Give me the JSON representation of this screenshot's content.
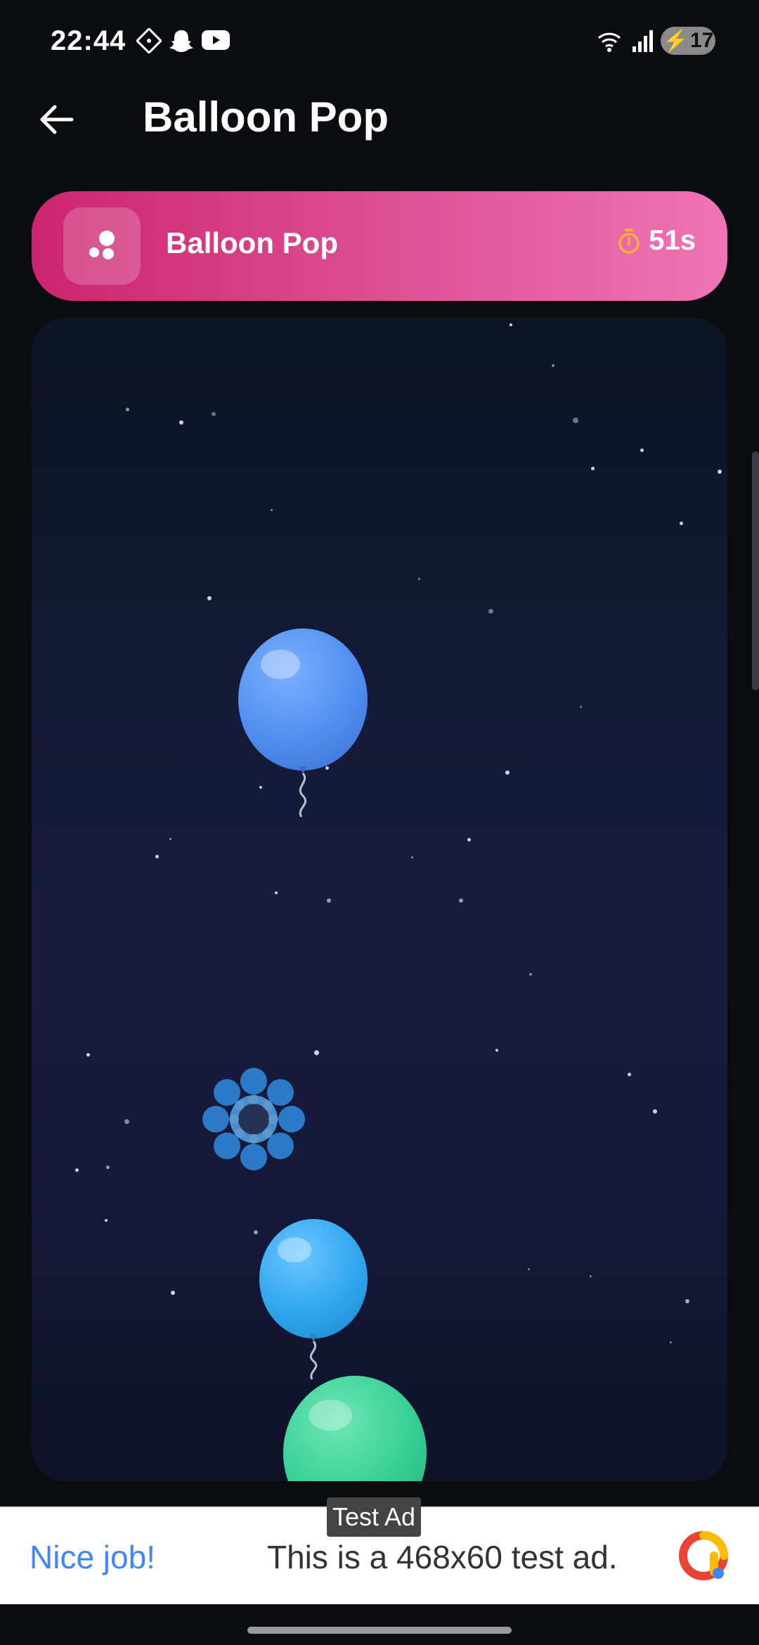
{
  "status_bar": {
    "time": "22:44",
    "battery_level": "17"
  },
  "app_bar": {
    "title": "Balloon Pop"
  },
  "game_header": {
    "title": "Balloon Pop",
    "timer": "51s",
    "accent_color": "#f2b233"
  },
  "game": {
    "balloons": [
      {
        "color": "#4f8ef0",
        "label": "blue balloon"
      },
      {
        "color": "#2fa6ee",
        "label": "light blue balloon"
      },
      {
        "color": "#34cf94",
        "label": "green balloon"
      }
    ],
    "pop_effect": {
      "color": "#2d7fcf"
    }
  },
  "ad": {
    "label": "Test Ad",
    "cta": "Nice job!",
    "text": "This is a 468x60 test ad."
  }
}
